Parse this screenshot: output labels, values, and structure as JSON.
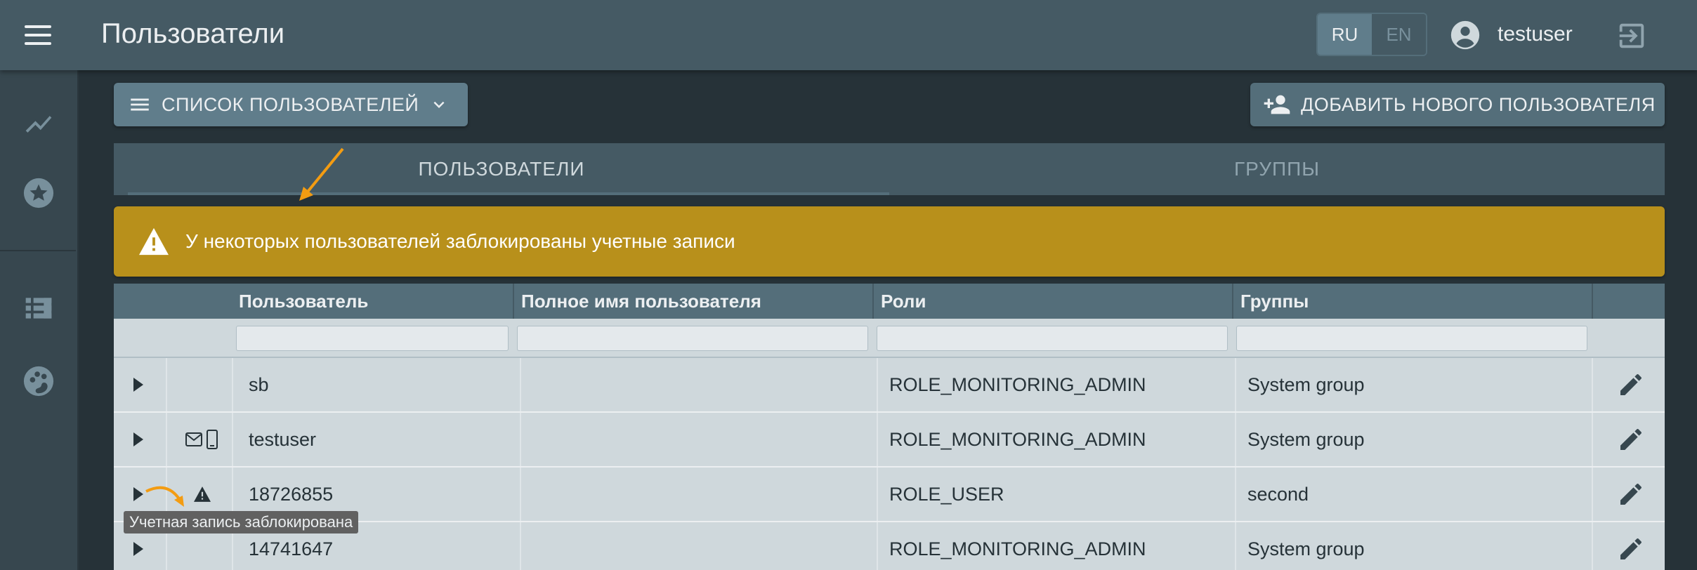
{
  "header": {
    "title": "Пользователи",
    "lang_ru": "RU",
    "lang_en": "EN",
    "username": "testuser"
  },
  "sidebar": {
    "items": [
      "chart-line-icon",
      "star-icon",
      "dashboard-icon",
      "palette-icon"
    ]
  },
  "toolbar": {
    "list_label": "СПИСОК ПОЛЬЗОВАТЕЛЕЙ",
    "add_label": "ДОБАВИТЬ НОВОГО ПОЛЬЗОВАТЕЛЯ"
  },
  "tabs": {
    "users": "ПОЛЬЗОВАТЕЛИ",
    "groups": "ГРУППЫ"
  },
  "warning": {
    "text": "У некоторых пользователей заблокированы учетные записи"
  },
  "table": {
    "columns": [
      "Пользователь",
      "Полное имя пользователя",
      "Роли",
      "Группы"
    ],
    "rows": [
      {
        "user": "sb",
        "full_name": "",
        "roles": "ROLE_MONITORING_ADMIN",
        "groups": "System group"
      },
      {
        "user": "testuser",
        "full_name": "",
        "roles": "ROLE_MONITORING_ADMIN",
        "groups": "System group"
      },
      {
        "user": "18726855",
        "full_name": "",
        "roles": "ROLE_USER",
        "groups": "second"
      },
      {
        "user": "14741647",
        "full_name": "",
        "roles": "ROLE_MONITORING_ADMIN",
        "groups": "System group"
      }
    ]
  },
  "tooltip": {
    "text": "Учетная запись заблокирована"
  },
  "colors": {
    "header_bg": "#455a64",
    "warning_bg": "#b8901b",
    "table_bg": "#cfd8dc",
    "annotation_arrow": "#f39c12"
  }
}
